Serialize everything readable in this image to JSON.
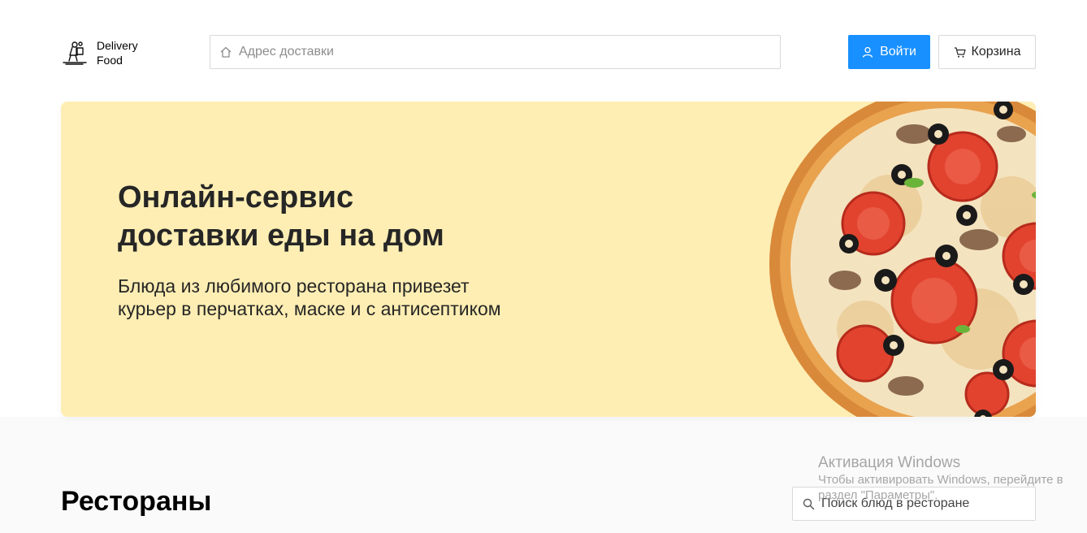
{
  "logo": {
    "line1": "Delivery",
    "line2": "Food"
  },
  "header": {
    "address_placeholder": "Адрес доставки",
    "login_label": "Войти",
    "cart_label": "Корзина"
  },
  "promo": {
    "title_line1": "Онлайн-сервис",
    "title_line2": "доставки еды на дом",
    "text": "Блюда из любимого ресторана привезет курьер в перчатках, маске и с антисептиком"
  },
  "restaurants": {
    "title": "Рестораны",
    "search_placeholder": "Поиск блюд в ресторане"
  },
  "watermark": {
    "title": "Активация Windows",
    "text": "Чтобы активировать Windows, перейдите в раздел \"Параметры\"."
  },
  "colors": {
    "accent": "#1890ff",
    "promo_bg": "#ffeeb3",
    "text": "#262626"
  },
  "icons": {
    "logo": "delivery-man-icon",
    "address": "home-icon",
    "login": "user-icon",
    "cart": "shopping-cart-icon",
    "search": "search-icon",
    "promo_image": "pizza-illustration"
  }
}
